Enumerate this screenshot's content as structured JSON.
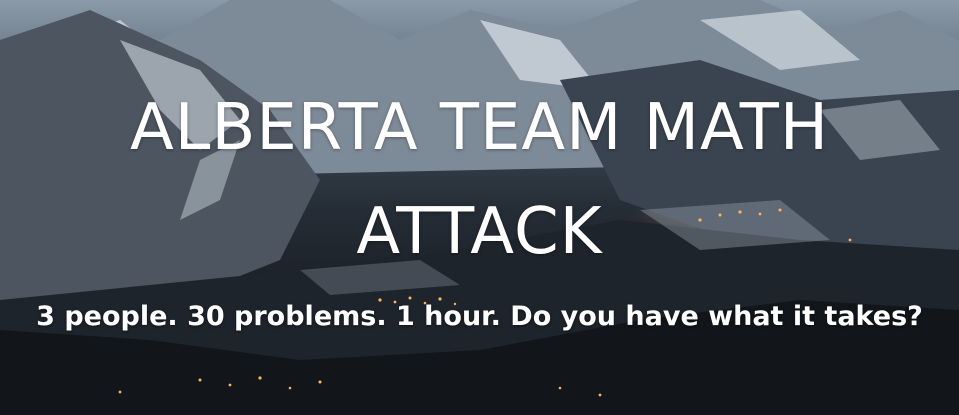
{
  "hero": {
    "title": "ALBERTA TEAM MATH ATTACK",
    "subtitle": "3 people. 30 problems. 1 hour. Do you have what it takes?"
  },
  "background": {
    "description_icon": "mountain-valley-night-image",
    "colors": {
      "sky_top": "#8a9aa8",
      "valley_dark": "#14181e",
      "town_lights": "#ffaa46",
      "text": "#ffffff"
    }
  }
}
